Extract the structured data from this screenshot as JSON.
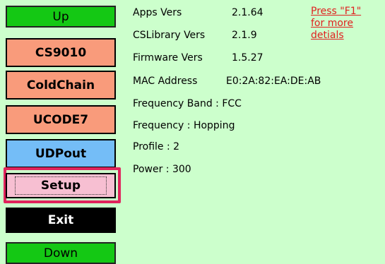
{
  "sidebar": {
    "up_label": "Up",
    "cs9010_label": "CS9010",
    "coldchain_label": "ColdChain",
    "ucode7_label": "UCODE7",
    "udpout_label": "UDPout",
    "setup_label": "Setup",
    "exit_label": "Exit",
    "down_label": "Down"
  },
  "info": {
    "apps_vers_label": "Apps Vers",
    "apps_vers_value": "2.1.64",
    "cslibrary_vers_label": "CSLibrary Vers",
    "cslibrary_vers_value": "2.1.9",
    "firmware_vers_label": "Firmware Vers",
    "firmware_vers_value": "1.5.27",
    "mac_address_label": "MAC Address",
    "mac_address_value": "E0:2A:82:EA:DE:AB",
    "frequency_band": "Frequency Band : FCC",
    "frequency": "Frequency : Hopping",
    "profile": "Profile : 2",
    "power": "Power : 300"
  },
  "hint": {
    "line1": "Press \"F1\"",
    "line2": "for more",
    "line3": "detials"
  },
  "colors": {
    "background": "#ccffcc",
    "nav_button": "#14c814",
    "orange_button": "#f99b7b",
    "blue_button": "#74bdf7",
    "setup_button": "#f7bfd2",
    "highlight_border": "#e0245c",
    "exit_button": "#000000",
    "hint_text": "#e02020"
  }
}
